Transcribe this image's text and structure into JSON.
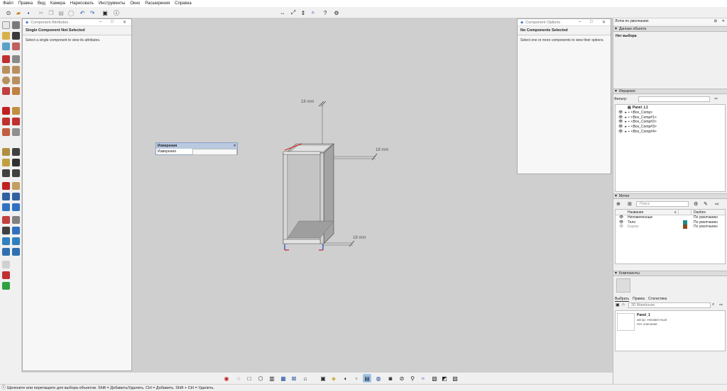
{
  "menu": [
    "Файл",
    "Правка",
    "Вид",
    "Камера",
    "Нарисовать",
    "Инструменты",
    "Окно",
    "Расширения",
    "Справка"
  ],
  "attributes_panel": {
    "title": "Component Attributes",
    "heading": "Single Component Not Selected",
    "body": "Select a single component to view its attributes."
  },
  "options_panel": {
    "title": "Component Options",
    "heading": "No Components Selected",
    "body": "Select one or more components to view their options."
  },
  "measurements": {
    "title": "Измерения",
    "label": "Измерения",
    "value": ""
  },
  "viewport": {
    "dim_top": "18 mm",
    "dim_right": "18 mm",
    "dim_bottom": "18 mm"
  },
  "tray": {
    "title": "Лоток по умолчанию",
    "entity_info": {
      "section": "Данные объекта",
      "selection": "Нет выбора"
    },
    "outliner": {
      "section": "Иерархия",
      "filter_label": "Фильтр:",
      "filter_value": "",
      "root": "Panel_L1",
      "items": [
        "<Box_Comp>",
        "<Box_Comp#1>",
        "<Box_Comp#2>",
        "<Box_Comp#3>",
        "<Box_Comp#4>"
      ]
    },
    "tags": {
      "section": "Метки",
      "search_placeholder": "Поиск",
      "col_name": "Название",
      "col_dashes": "Dashes",
      "rows": [
        {
          "name": "Непомеченные",
          "color": "",
          "dashes": "По умолчанию"
        },
        {
          "name": "Тело",
          "color": "#1c8a8a",
          "dashes": "По умолчанию"
        },
        {
          "name": "Каркас",
          "color": "#8a4a1c",
          "dashes": "По умолчанию"
        }
      ]
    },
    "components": {
      "section": "Компоненты",
      "tabs": [
        "Выбрать",
        "Правка",
        "Статистика"
      ],
      "search_placeholder": "3D Warehouse",
      "item_name": "Panel_1",
      "item_author_label": "автор:",
      "item_author": "Неизвестный",
      "item_desc": "Нет описания"
    }
  },
  "status": "Щелкните или перетащите для выбора объектов. Shift = Добавить/Удалить. Ctrl = Добавить. Shift + Ctrl = Удалить.",
  "colors": {
    "viewport_bg": "#cfcfcf",
    "red_axis": "#d42020",
    "blue_axis": "#2040d0",
    "tag_body": "#1c8a8a",
    "tag_frame": "#8a4a1c"
  }
}
